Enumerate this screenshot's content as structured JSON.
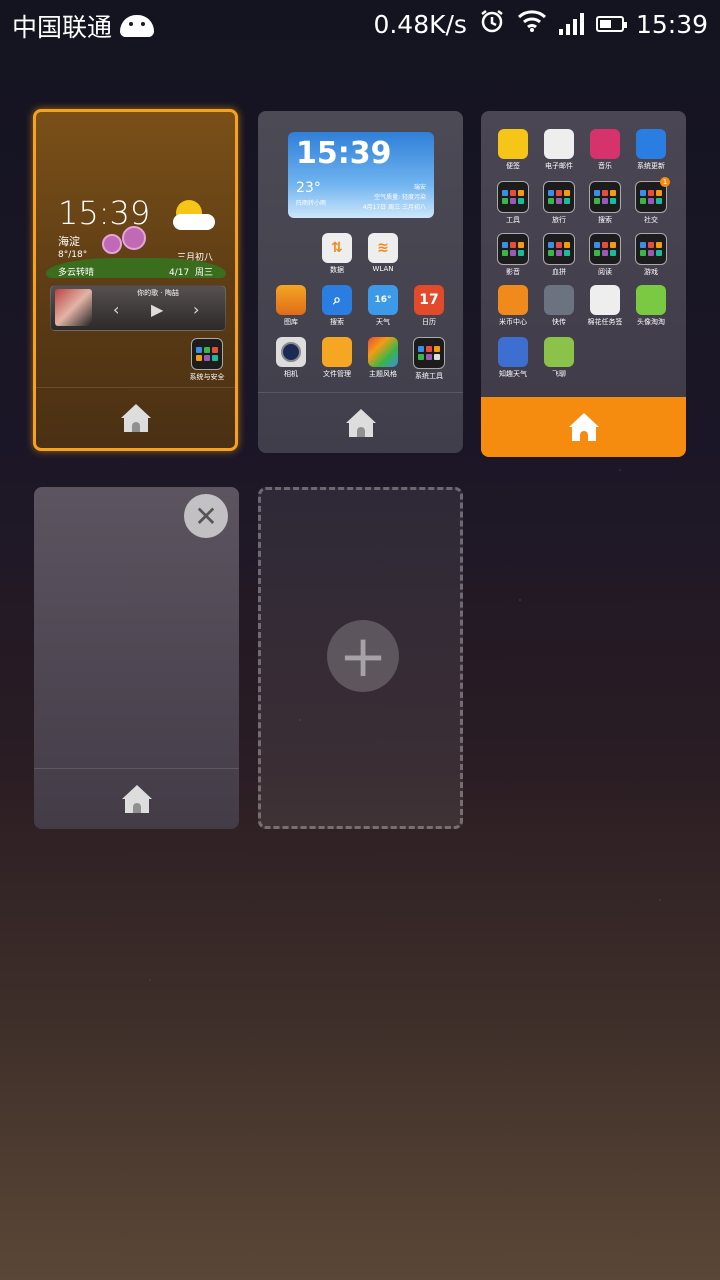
{
  "status_bar": {
    "carrier": "中国联通",
    "speed": "0.48K/s",
    "time": "15:39"
  },
  "screens": [
    {
      "label": "screen-1",
      "selected": true,
      "clock_widget": {
        "time": "15:39",
        "city": "海淀",
        "temp_range": "8°/18°",
        "lunar": "三月初八",
        "weather": "多云转晴",
        "date": "4/17",
        "weekday": "周三"
      },
      "music_widget": {
        "song": "你的歌 · 陶喆"
      },
      "apps": [
        {
          "label": "系统与安全"
        }
      ]
    },
    {
      "label": "screen-2",
      "clock_widget": {
        "time": "15:39",
        "temp": "23°",
        "location": "瑞安",
        "air_quality": "空气质量: 轻度污染",
        "weather": "阵雨转小雨",
        "date": "4月17日 周三 三月初八"
      },
      "apps": [
        {
          "label": "数据"
        },
        {
          "label": "WLAN"
        },
        {
          "label": "图库"
        },
        {
          "label": "搜索"
        },
        {
          "label": "天气"
        },
        {
          "label": "日历"
        },
        {
          "label": "相机"
        },
        {
          "label": "文件管理"
        },
        {
          "label": "主题风格"
        },
        {
          "label": "系统工具"
        }
      ],
      "weather_icon_text": "16°",
      "calendar_icon_text": "17"
    },
    {
      "label": "screen-3",
      "is_home": true,
      "apps": [
        {
          "label": "便签"
        },
        {
          "label": "电子邮件"
        },
        {
          "label": "音乐"
        },
        {
          "label": "系统更新"
        },
        {
          "label": "工具"
        },
        {
          "label": "旅行"
        },
        {
          "label": "搜索"
        },
        {
          "label": "社交"
        },
        {
          "label": "影音"
        },
        {
          "label": "血拼"
        },
        {
          "label": "阅读"
        },
        {
          "label": "游戏"
        },
        {
          "label": "米币中心"
        },
        {
          "label": "快传"
        },
        {
          "label": "棉花任务签"
        },
        {
          "label": "头像淘淘"
        },
        {
          "label": "知趣天气"
        },
        {
          "label": "飞聊"
        }
      ],
      "social_badge": "1"
    },
    {
      "label": "screen-4",
      "removable": true
    },
    {
      "label": "add-screen"
    }
  ],
  "colors": {
    "accent": "#f68c0f",
    "selected_border": "#f6a21e"
  },
  "icons": {
    "close": "close-icon",
    "add": "plus-icon",
    "home": "home-icon"
  }
}
